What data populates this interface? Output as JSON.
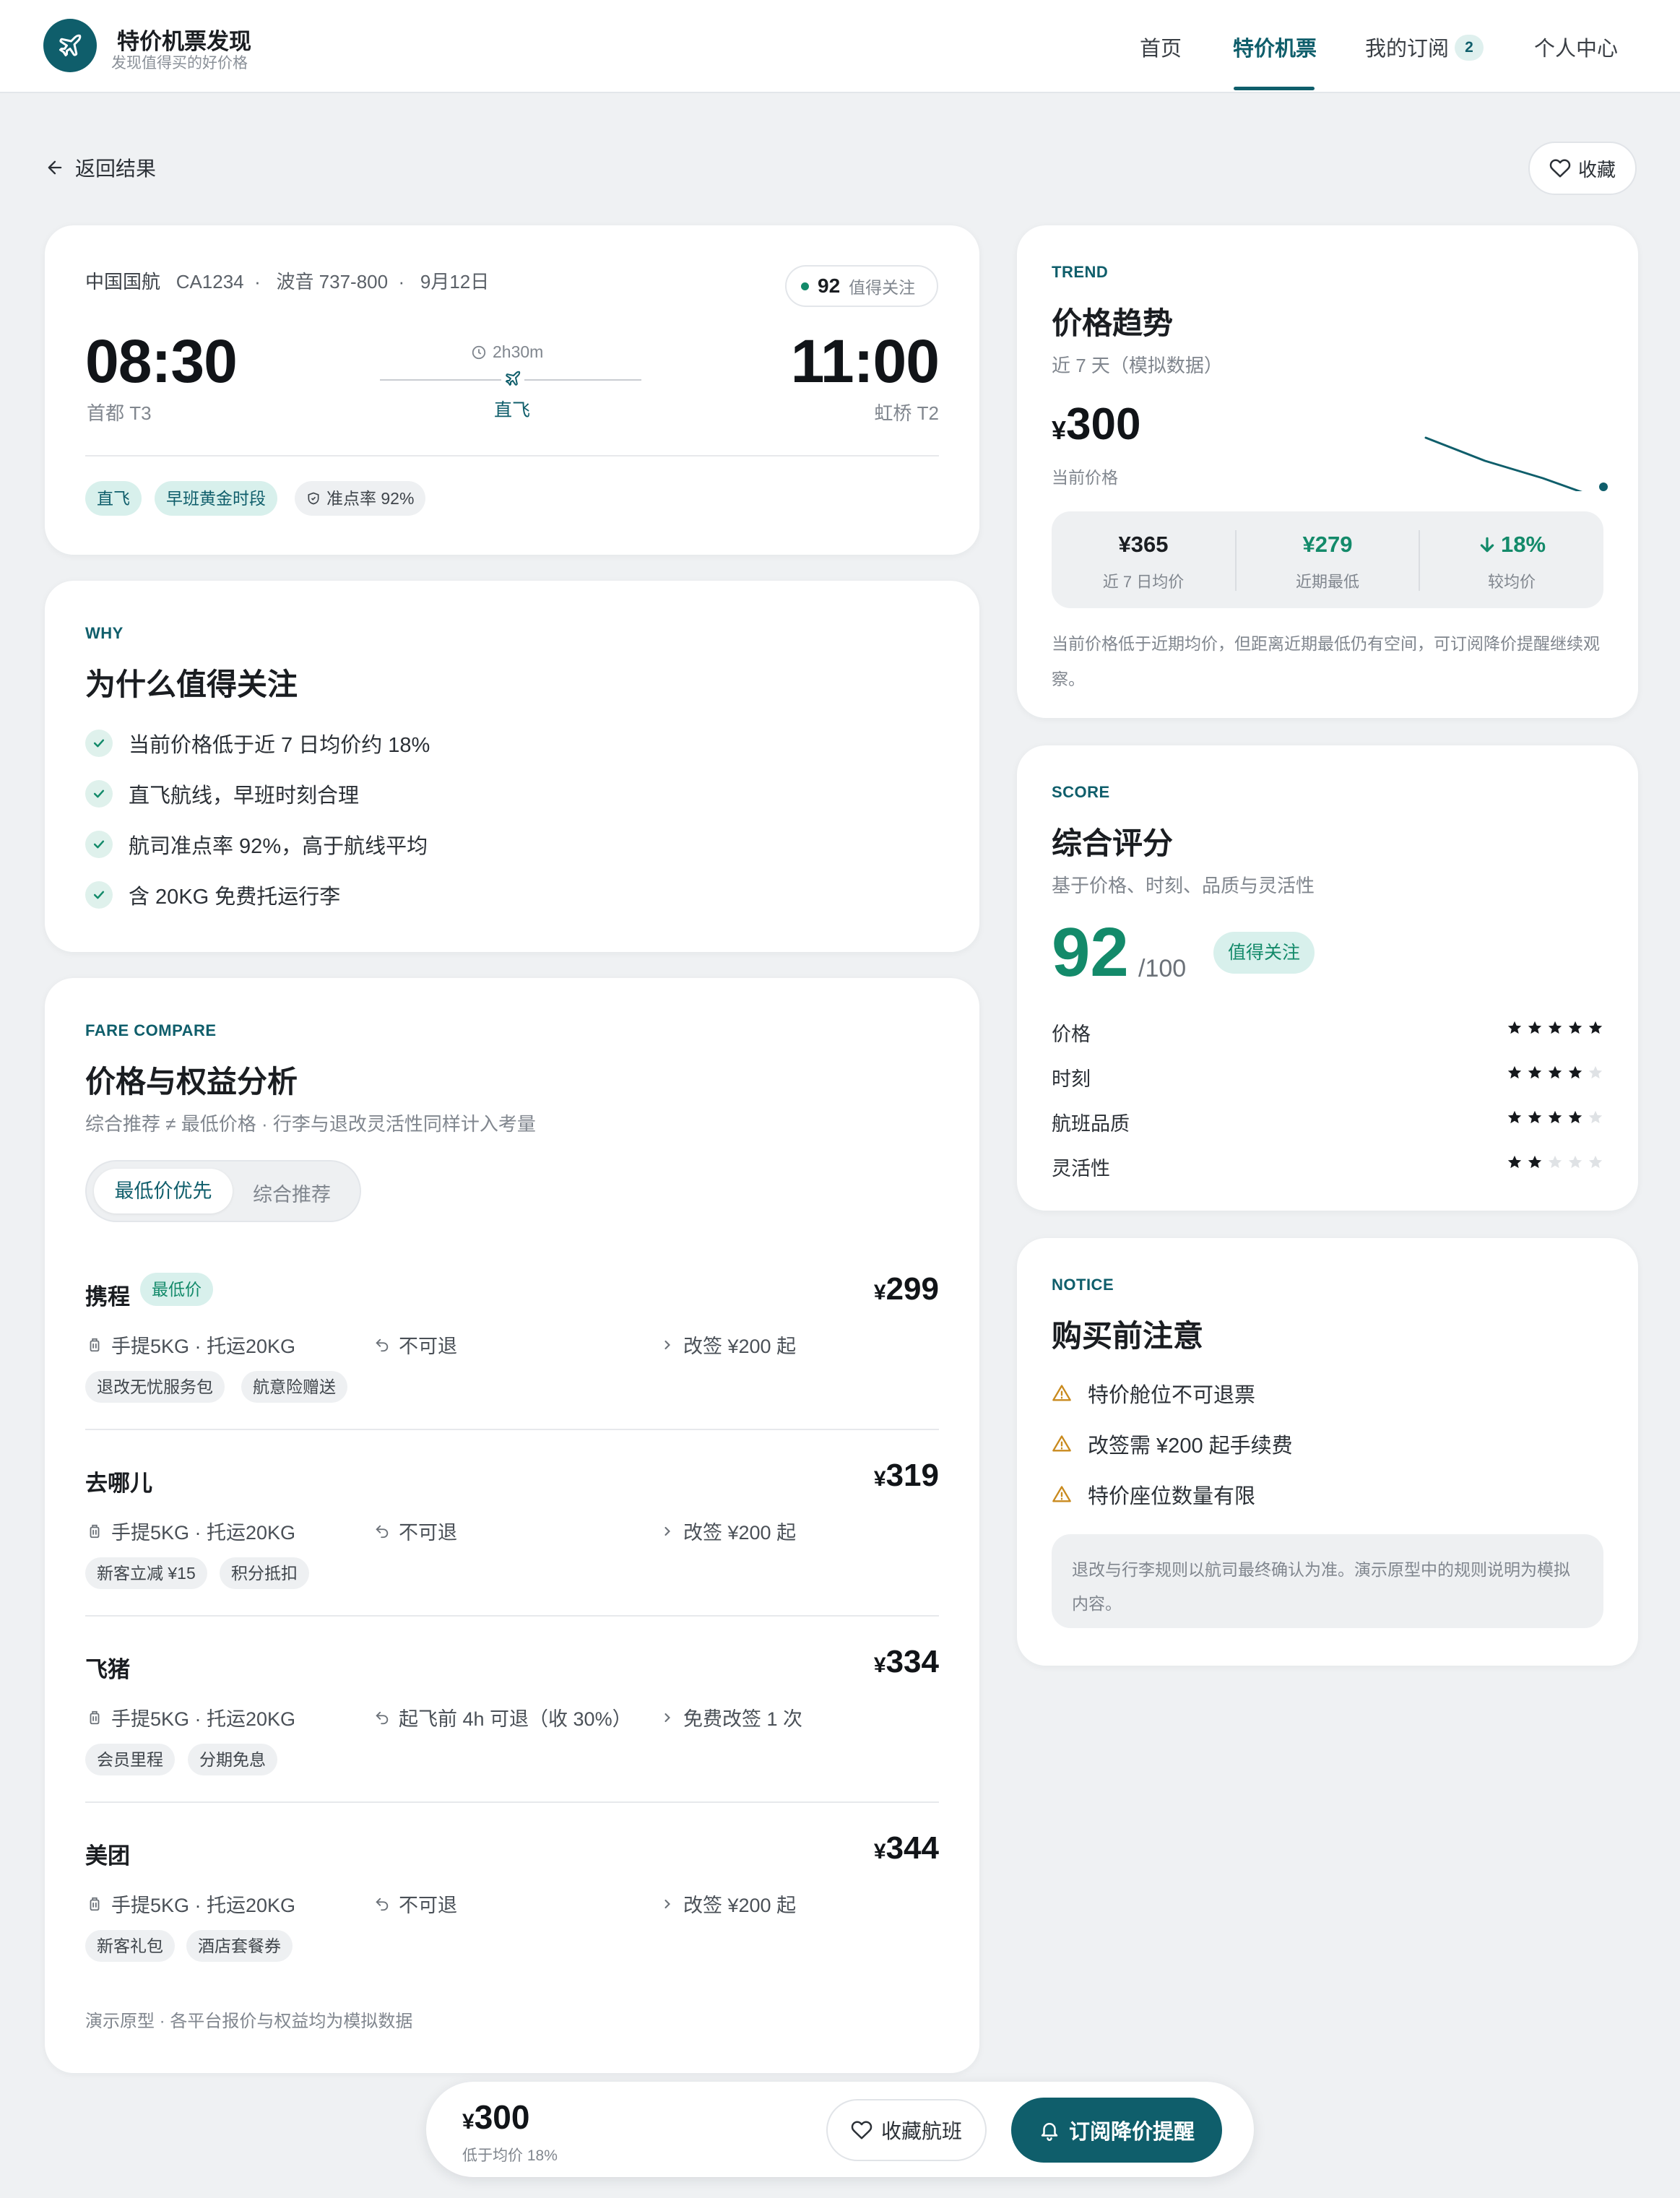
{
  "brand": {
    "title": "特价机票发现",
    "subtitle": "发现值得买的好价格"
  },
  "nav": {
    "home": "首页",
    "deals": "特价机票",
    "subs": "我的订阅",
    "subs_count": "2",
    "profile": "个人中心"
  },
  "back_label": "返回结果",
  "favorite_label": "收藏",
  "flight": {
    "airline": "中国国航",
    "flight_no": "CA1234",
    "aircraft": "波音 737-800",
    "date": "9月12日",
    "score": "92",
    "score_label": "值得关注",
    "dep_time": "08:30",
    "dep_airport": "首都 T3",
    "arr_time": "11:00",
    "arr_airport": "虹桥 T2",
    "duration": "2h30m",
    "direct": "直飞",
    "tags": [
      "直飞",
      "早班黄金时段",
      "准点率 92%"
    ]
  },
  "why": {
    "eyebrow": "WHY",
    "title": "为什么值得关注",
    "items": [
      "当前价格低于近 7 日均价约 18%",
      "直飞航线，早班时刻合理",
      "航司准点率 92%，高于航线平均",
      "含 20KG 免费托运行李"
    ]
  },
  "fare": {
    "eyebrow": "FARE COMPARE",
    "title": "价格与权益分析",
    "subtitle": "综合推荐 ≠ 最低价格 · 行李与退改灵活性同样计入考量",
    "seg_on": "最低价优先",
    "seg_off": "综合推荐",
    "best_label": "最低价",
    "items": [
      {
        "name": "携程",
        "price": "299",
        "baggage": "手提5KG · 托运20KG",
        "refund": "不可退",
        "change": "改签 ¥200 起",
        "tags": [
          "退改无忧服务包",
          "航意险赠送"
        ]
      },
      {
        "name": "去哪儿",
        "price": "319",
        "baggage": "手提5KG · 托运20KG",
        "refund": "不可退",
        "change": "改签 ¥200 起",
        "tags": [
          "新客立减 ¥15",
          "积分抵扣"
        ]
      },
      {
        "name": "飞猪",
        "price": "334",
        "baggage": "手提5KG · 托运20KG",
        "refund": "起飞前 4h 可退（收 30%）",
        "change": "免费改签 1 次",
        "tags": [
          "会员里程",
          "分期免息"
        ]
      },
      {
        "name": "美团",
        "price": "344",
        "baggage": "手提5KG · 托运20KG",
        "refund": "不可退",
        "change": "改签 ¥200 起",
        "tags": [
          "新客礼包",
          "酒店套餐券"
        ]
      }
    ],
    "note": "演示原型 · 各平台报价与权益均为模拟数据"
  },
  "trend": {
    "eyebrow": "TREND",
    "title": "价格趋势",
    "subtitle": "近 7 天（模拟数据）",
    "price": "300",
    "price_label": "当前价格",
    "avg": "¥365",
    "avg_label": "近 7 日均价",
    "low": "¥279",
    "low_label": "近期最低",
    "diff": "18%",
    "diff_label": "较均价",
    "note": "当前价格低于近期均价，但距离近期最低仍有空间，可订阅降价提醒继续观察。",
    "colors": {
      "line": "#0f5e6b",
      "low": "#138a6a"
    }
  },
  "score": {
    "eyebrow": "SCORE",
    "title": "综合评分",
    "subtitle": "基于价格、时刻、品质与灵活性",
    "value": "92",
    "of": "/100",
    "badge": "值得关注",
    "rows": [
      {
        "label": "价格",
        "stars": 5
      },
      {
        "label": "时刻",
        "stars": 4
      },
      {
        "label": "航班品质",
        "stars": 4
      },
      {
        "label": "灵活性",
        "stars": 2
      }
    ]
  },
  "notice": {
    "eyebrow": "NOTICE",
    "title": "购买前注意",
    "items": [
      "特价舱位不可退票",
      "改签需 ¥200 起手续费",
      "特价座位数量有限"
    ],
    "box": "退改与行李规则以航司最终确认为准。演示原型中的规则说明为模拟内容。"
  },
  "bottom": {
    "price": "300",
    "sub": "低于均价 18%",
    "fav": "收藏航班",
    "subscribe": "订阅降价提醒"
  },
  "colors": {
    "accent": "#0f5e6b",
    "green": "#138a6a",
    "warn": "#c98a1e"
  }
}
